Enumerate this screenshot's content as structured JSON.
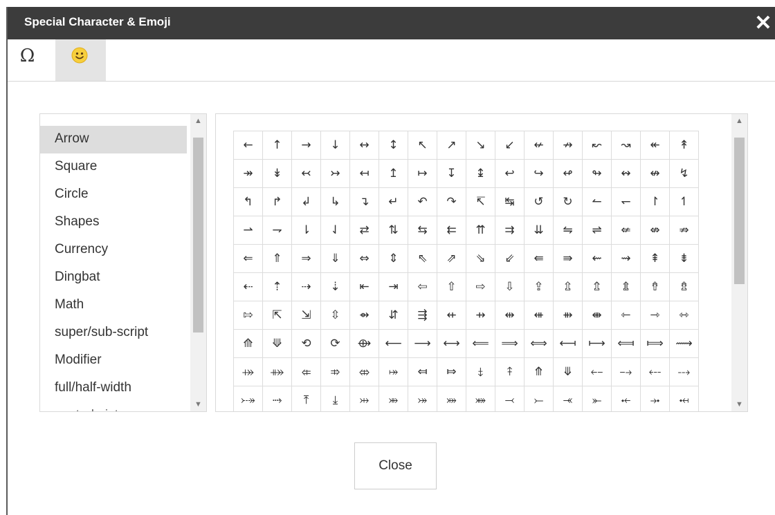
{
  "dialog": {
    "title": "Special Character & Emoji",
    "close_icon": "✕"
  },
  "tabs": [
    {
      "name": "symbols",
      "icon": "omega-icon",
      "glyph": "Ω"
    },
    {
      "name": "emoji",
      "icon": "smiley-icon",
      "selected": true
    }
  ],
  "categories": {
    "selected": "Arrow",
    "items": [
      "Arrow",
      "Square",
      "Circle",
      "Shapes",
      "Currency",
      "Dingbat",
      "Math",
      "super/sub-script",
      "Modifier",
      "full/half-width",
      "control pict"
    ]
  },
  "characters": [
    [
      "←",
      "↑",
      "→",
      "↓",
      "↔",
      "↕",
      "↖",
      "↗",
      "↘",
      "↙",
      "↚",
      "↛",
      "↜",
      "↝",
      "↞",
      "↟"
    ],
    [
      "↠",
      "↡",
      "↢",
      "↣",
      "↤",
      "↥",
      "↦",
      "↧",
      "↨",
      "↩",
      "↪",
      "↫",
      "↬",
      "↭",
      "↮",
      "↯"
    ],
    [
      "↰",
      "↱",
      "↲",
      "↳",
      "↴",
      "↵",
      "↶",
      "↷",
      "↸",
      "↹",
      "↺",
      "↻",
      "↼",
      "↽",
      "↾",
      "↿"
    ],
    [
      "⇀",
      "⇁",
      "⇂",
      "⇃",
      "⇄",
      "⇅",
      "⇆",
      "⇇",
      "⇈",
      "⇉",
      "⇊",
      "⇋",
      "⇌",
      "⇍",
      "⇎",
      "⇏"
    ],
    [
      "⇐",
      "⇑",
      "⇒",
      "⇓",
      "⇔",
      "⇕",
      "⇖",
      "⇗",
      "⇘",
      "⇙",
      "⇚",
      "⇛",
      "⇜",
      "⇝",
      "⇞",
      "⇟"
    ],
    [
      "⇠",
      "⇡",
      "⇢",
      "⇣",
      "⇤",
      "⇥",
      "⇦",
      "⇧",
      "⇨",
      "⇩",
      "⇪",
      "⇫",
      "⇬",
      "⇭",
      "⇮",
      "⇯"
    ],
    [
      "⇰",
      "⇱",
      "⇲",
      "⇳",
      "⇴",
      "⇵",
      "⇶",
      "⇷",
      "⇸",
      "⇹",
      "⇺",
      "⇻",
      "⇼",
      "⇽",
      "⇾",
      "⇿"
    ],
    [
      "⟰",
      "⟱",
      "⟲",
      "⟳",
      "⟴",
      "⟵",
      "⟶",
      "⟷",
      "⟸",
      "⟹",
      "⟺",
      "⟻",
      "⟼",
      "⟽",
      "⟾",
      "⟿"
    ],
    [
      "⤀",
      "⤁",
      "⤂",
      "⤃",
      "⤄",
      "⤅",
      "⤆",
      "⤇",
      "⤈",
      "⤉",
      "⤊",
      "⤋",
      "⤌",
      "⤍",
      "⤎",
      "⤏"
    ],
    [
      "⤐",
      "⤑",
      "⤒",
      "⤓",
      "⤔",
      "⤕",
      "⤖",
      "⤗",
      "⤘",
      "⤙",
      "⤚",
      "⤛",
      "⤜",
      "⤝",
      "⤞",
      "⤟"
    ]
  ],
  "buttons": {
    "close_label": "Close"
  },
  "colors": {
    "titlebar": "#3c3c3c",
    "selected_bg": "#dddddd",
    "tab_active_bg": "#e4e4e4"
  }
}
